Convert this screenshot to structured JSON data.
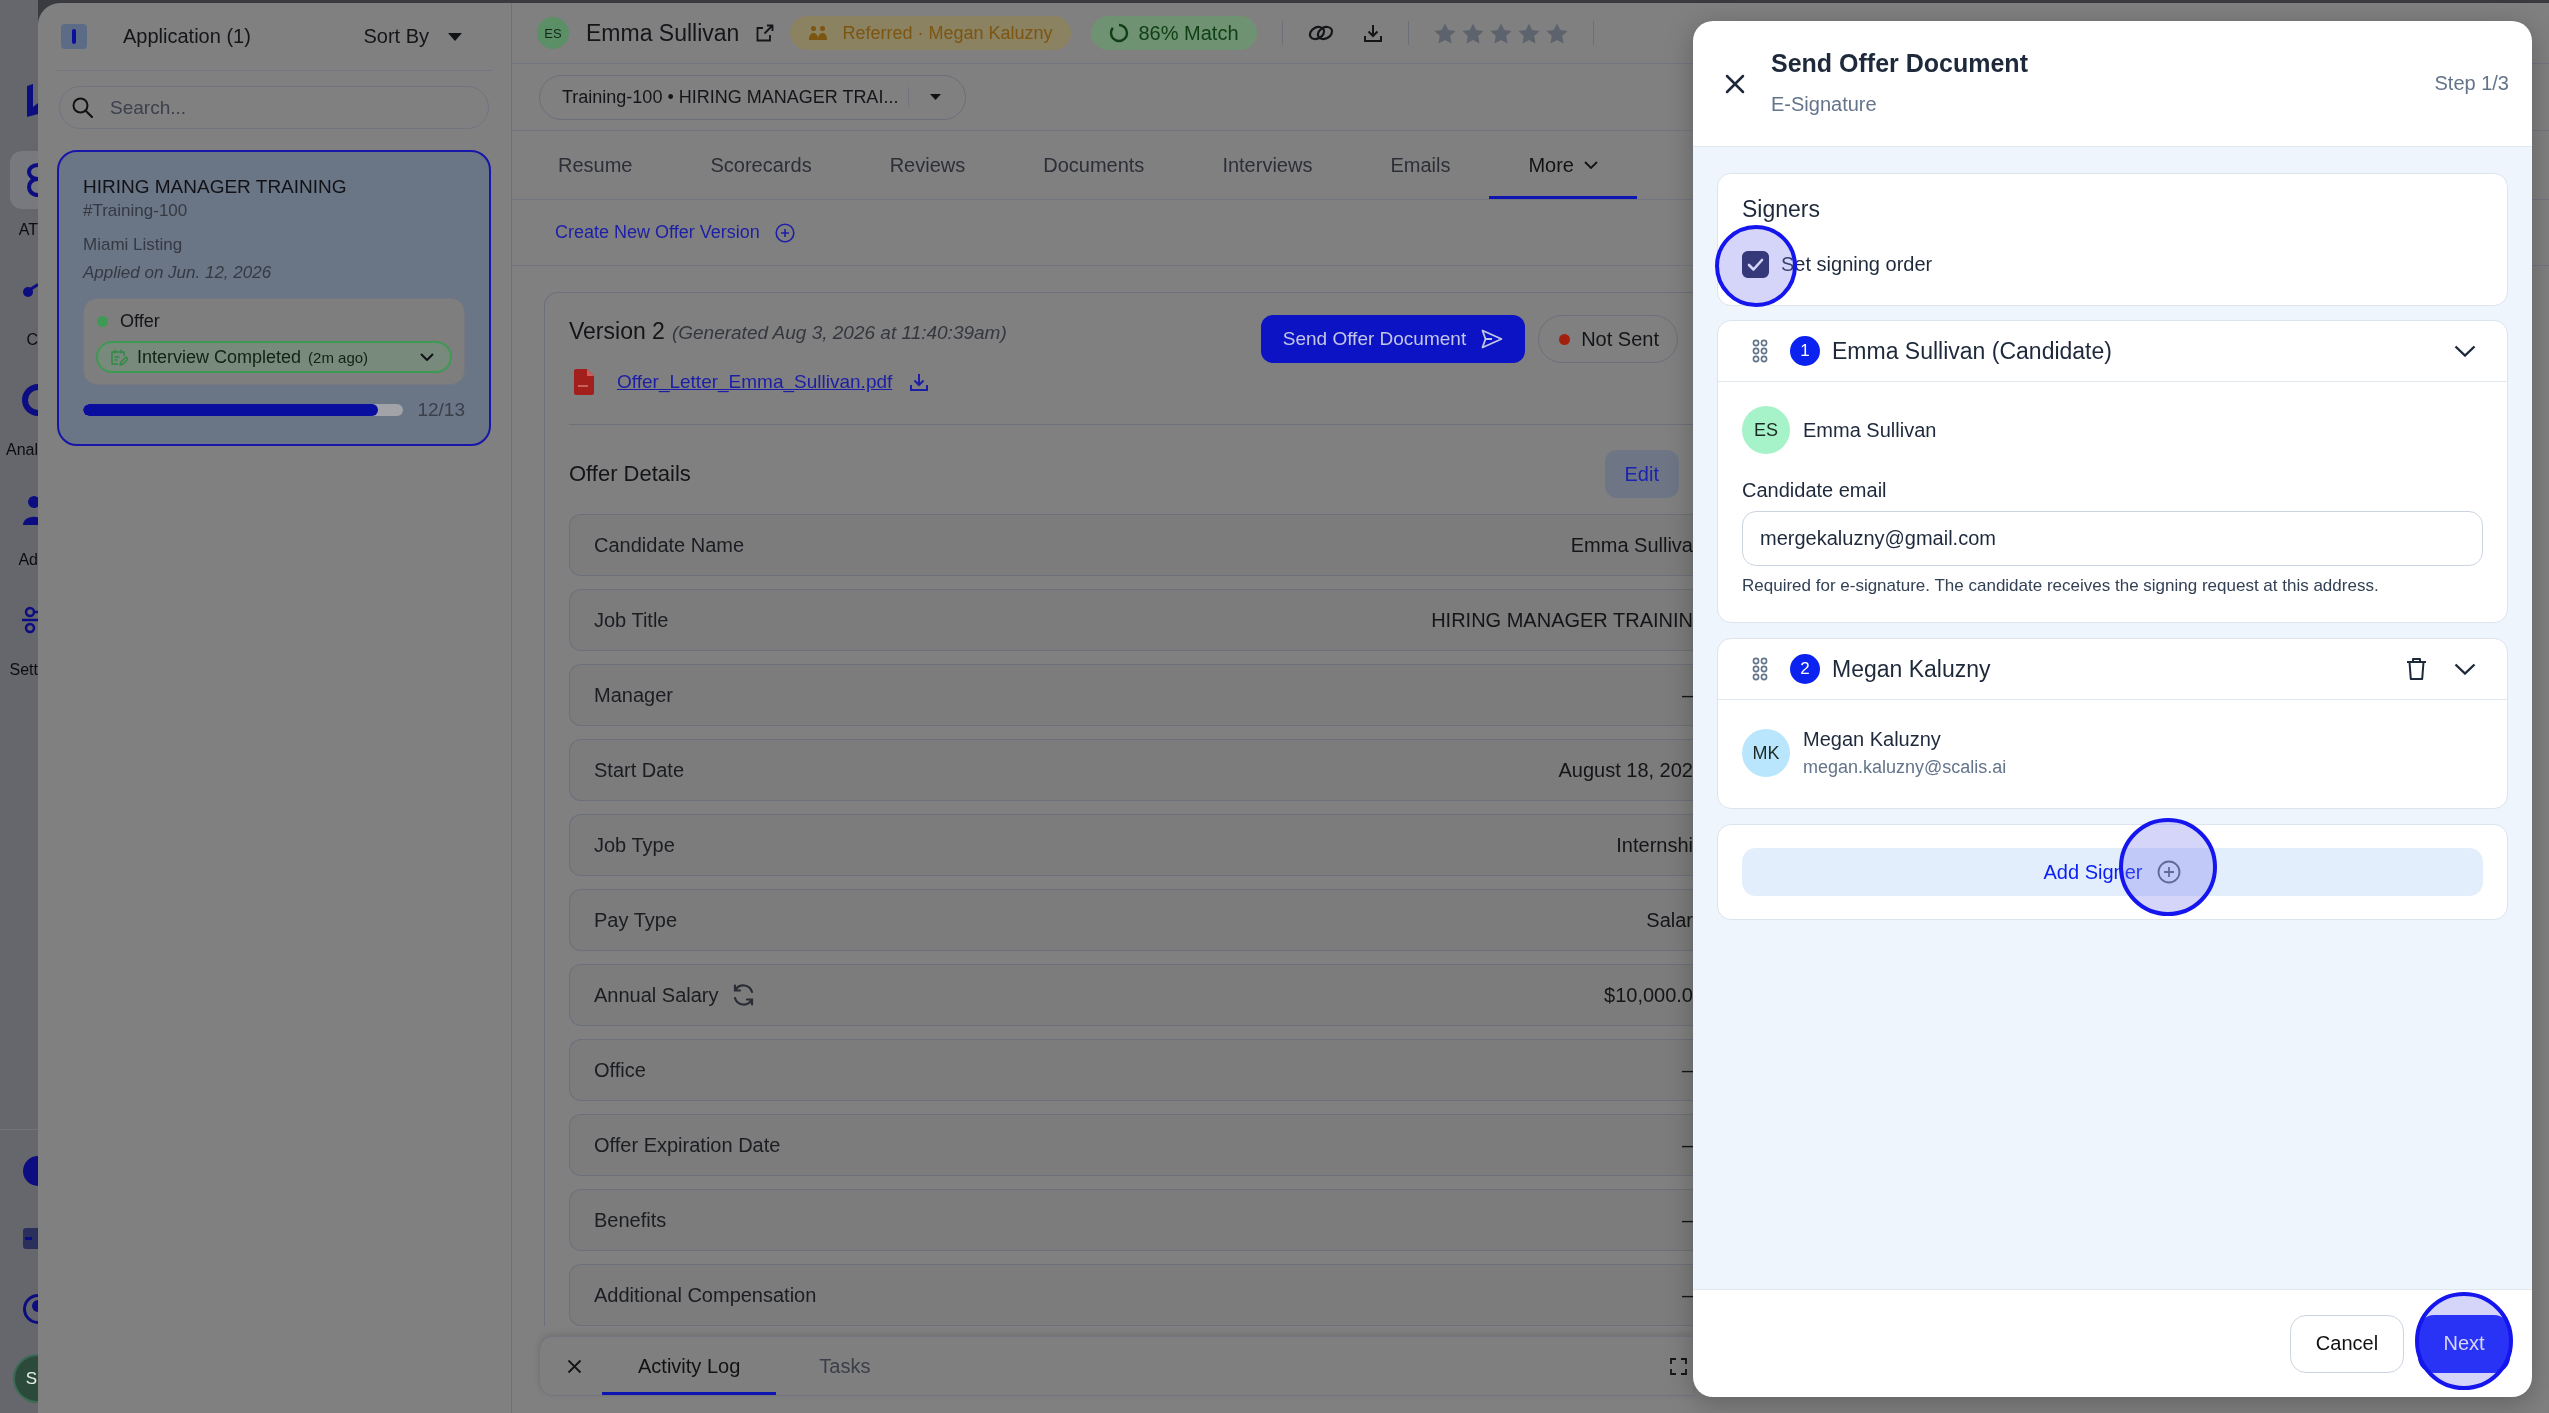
{
  "rail": {
    "items": [
      {
        "label": "AT",
        "selected": true
      },
      {
        "label": "C",
        "selected": false
      },
      {
        "label": "Anal",
        "selected": false
      },
      {
        "label": "Ad",
        "selected": false
      },
      {
        "label": "Sett",
        "selected": false
      }
    ],
    "avatar": "S"
  },
  "applications": {
    "title": "Application (1)",
    "sort": "Sort By",
    "search": {
      "placeholder": "Search..."
    },
    "cards": [
      {
        "title": "HIRING MANAGER TRAINING",
        "code": "#Training-100",
        "location": "Miami Listing",
        "applied": "Applied on Jun. 12, 2026",
        "stage": "Offer",
        "status": "Interview Completed",
        "status_time": "(2m ago)",
        "progress": {
          "level": 0.92,
          "label": "12/13"
        },
        "selected": true
      }
    ]
  },
  "candidate": {
    "initials": "ES",
    "name": "Emma Sullivan",
    "referral": "Referred · Megan Kaluzny",
    "match": "86% Match",
    "rating": {
      "stars": 0
    }
  },
  "job_select": {
    "value": "Training-100 • HIRING MANAGER TRAI..."
  },
  "tabs": [
    {
      "label": "Resume",
      "kind": "tab",
      "selected": false
    },
    {
      "label": "Scorecards",
      "kind": "tab",
      "selected": false
    },
    {
      "label": "Reviews",
      "kind": "tab",
      "selected": false
    },
    {
      "label": "Documents",
      "kind": "tab",
      "selected": false
    },
    {
      "label": "Interviews",
      "kind": "tab",
      "selected": false
    },
    {
      "label": "Emails",
      "kind": "tab",
      "selected": false
    },
    {
      "label": "More",
      "kind": "menu",
      "selected": true
    }
  ],
  "create_link": "Create New Offer Version",
  "version": {
    "title": "Version 2",
    "generated": "(Generated Aug 3, 2026 at 11:40:39am)",
    "file": "Offer_Letter_Emma_Sullivan.pdf",
    "send_button": "Send Offer Document",
    "status": "Not Sent"
  },
  "offer_details": {
    "title": "Offer Details",
    "edit_button": "Edit",
    "rows": [
      {
        "label": "Candidate Name",
        "value": "Emma Sulliva",
        "kind": "text"
      },
      {
        "label": "Job Title",
        "value": "HIRING MANAGER TRAININ",
        "kind": "text"
      },
      {
        "label": "Manager",
        "value": "–",
        "kind": "text"
      },
      {
        "label": "Start Date",
        "value": "August 18, 202",
        "kind": "text"
      },
      {
        "label": "Job Type",
        "value": "Internshi",
        "kind": "text"
      },
      {
        "label": "Pay Type",
        "value": "Salar",
        "kind": "text"
      },
      {
        "label": "Annual Salary",
        "value": "$10,000.0",
        "kind": "synced"
      },
      {
        "label": "Office",
        "value": "–",
        "kind": "text"
      },
      {
        "label": "Offer Expiration Date",
        "value": "–",
        "kind": "text"
      },
      {
        "label": "Benefits",
        "value": "–",
        "kind": "text"
      },
      {
        "label": "Additional Compensation",
        "value": "–",
        "kind": "text"
      }
    ]
  },
  "bottom_panel": {
    "tabs": [
      {
        "label": "Activity Log",
        "selected": true
      },
      {
        "label": "Tasks",
        "selected": false
      }
    ]
  },
  "modal": {
    "title": "Send Offer Document",
    "subtitle": "E-Signature",
    "step": "Step 1/3",
    "signers_card": {
      "title": "Signers",
      "set_signing_order": {
        "label": "Set signing order",
        "checked": true
      }
    },
    "signers": [
      {
        "kind": "candidate",
        "number": "1",
        "name": "Emma Sullivan (Candidate)",
        "expanded": true,
        "initials": "ES",
        "color": "#a7f3c9",
        "person": "Emma Sullivan",
        "email_label": "Candidate email",
        "email": "mergekaluzny@gmail.com",
        "helper": "Required for e-signature. The candidate receives the signing request at this address."
      },
      {
        "kind": "internal",
        "number": "2",
        "name": "Megan Kaluzny",
        "expanded": true,
        "initials": "MK",
        "color": "#bae6fd",
        "person": "Megan Kaluzny",
        "email": "megan.kaluzny@scalis.ai"
      }
    ],
    "add_signer": "Add Signer",
    "cancel_button": "Cancel",
    "next_button": "Next"
  }
}
